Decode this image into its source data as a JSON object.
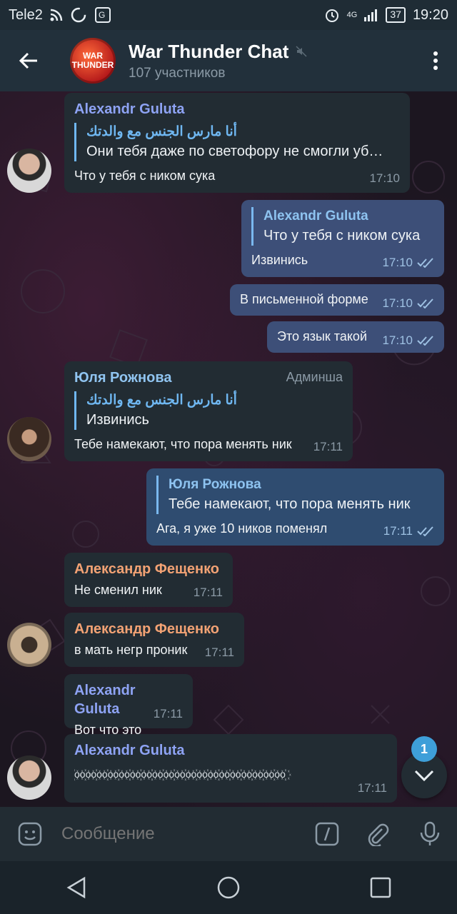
{
  "status_bar": {
    "carrier": "Tele2",
    "network": "4G",
    "battery": "37",
    "time": "19:20"
  },
  "header": {
    "title": "War Thunder Chat",
    "subtitle": "107 участников",
    "avatar_text": "WAR THUNDER"
  },
  "messages": [
    {
      "sender": "Alexandr Guluta",
      "reply_name": "أنا مارس الجنس مع والدتك",
      "reply_text": "Они тебя даже по светофору не смогли уб…",
      "text": "Что у тебя с ником сука",
      "time": "17:10"
    },
    {
      "reply_name": "Alexandr Guluta",
      "reply_text": "Что у тебя с ником сука",
      "text": "Извинись",
      "time": "17:10"
    },
    {
      "text": "В письменной форме",
      "time": "17:10"
    },
    {
      "text": "Это язык такой",
      "time": "17:10"
    },
    {
      "sender": "Юля Рожнова",
      "role": "Админша",
      "reply_name": "أنا مارس الجنس مع والدتك",
      "reply_text": "Извинись",
      "text": "Тебе намекают, что пора менять ник",
      "time": "17:11"
    },
    {
      "reply_name": "Юля Рожнова",
      "reply_text": "Тебе намекают, что пора менять ник",
      "text": "Ага, я уже 10 ников поменял",
      "time": "17:11"
    },
    {
      "sender": "Александр Фещенко",
      "text": "Не сменил ник",
      "time": "17:11"
    },
    {
      "sender": "Александр Фещенко",
      "text": "в мать негр проник",
      "time": "17:11"
    },
    {
      "sender": "Alexandr Guluta",
      "text": "Вот что это",
      "time": "17:11"
    },
    {
      "sender": "Alexandr Guluta",
      "text": "꙰oo꙰oo꙰oo꙰oo꙰oo꙰oo꙰oo꙰oo꙰oo꙰oo꙰oo꙰oo꙰oo꙰oo꙰oo꙰oo꙰oo꙰oo꙰oo꙰",
      "time": "17:11"
    }
  ],
  "scroll_badge": "1",
  "input": {
    "placeholder": "Сообщение"
  },
  "icons": {
    "back": "arrow-left-icon",
    "menu": "more-vert-icon",
    "mute": "mute-icon",
    "emoji": "emoji-icon",
    "command": "slash-command-icon",
    "attach": "paperclip-icon",
    "mic": "microphone-icon",
    "read": "double-check-icon"
  },
  "colors": {
    "header_bg": "#22303b",
    "incoming_bubble": "#222c33",
    "outgoing_bubble": "#2b5278",
    "accent": "#6fb7f1"
  }
}
